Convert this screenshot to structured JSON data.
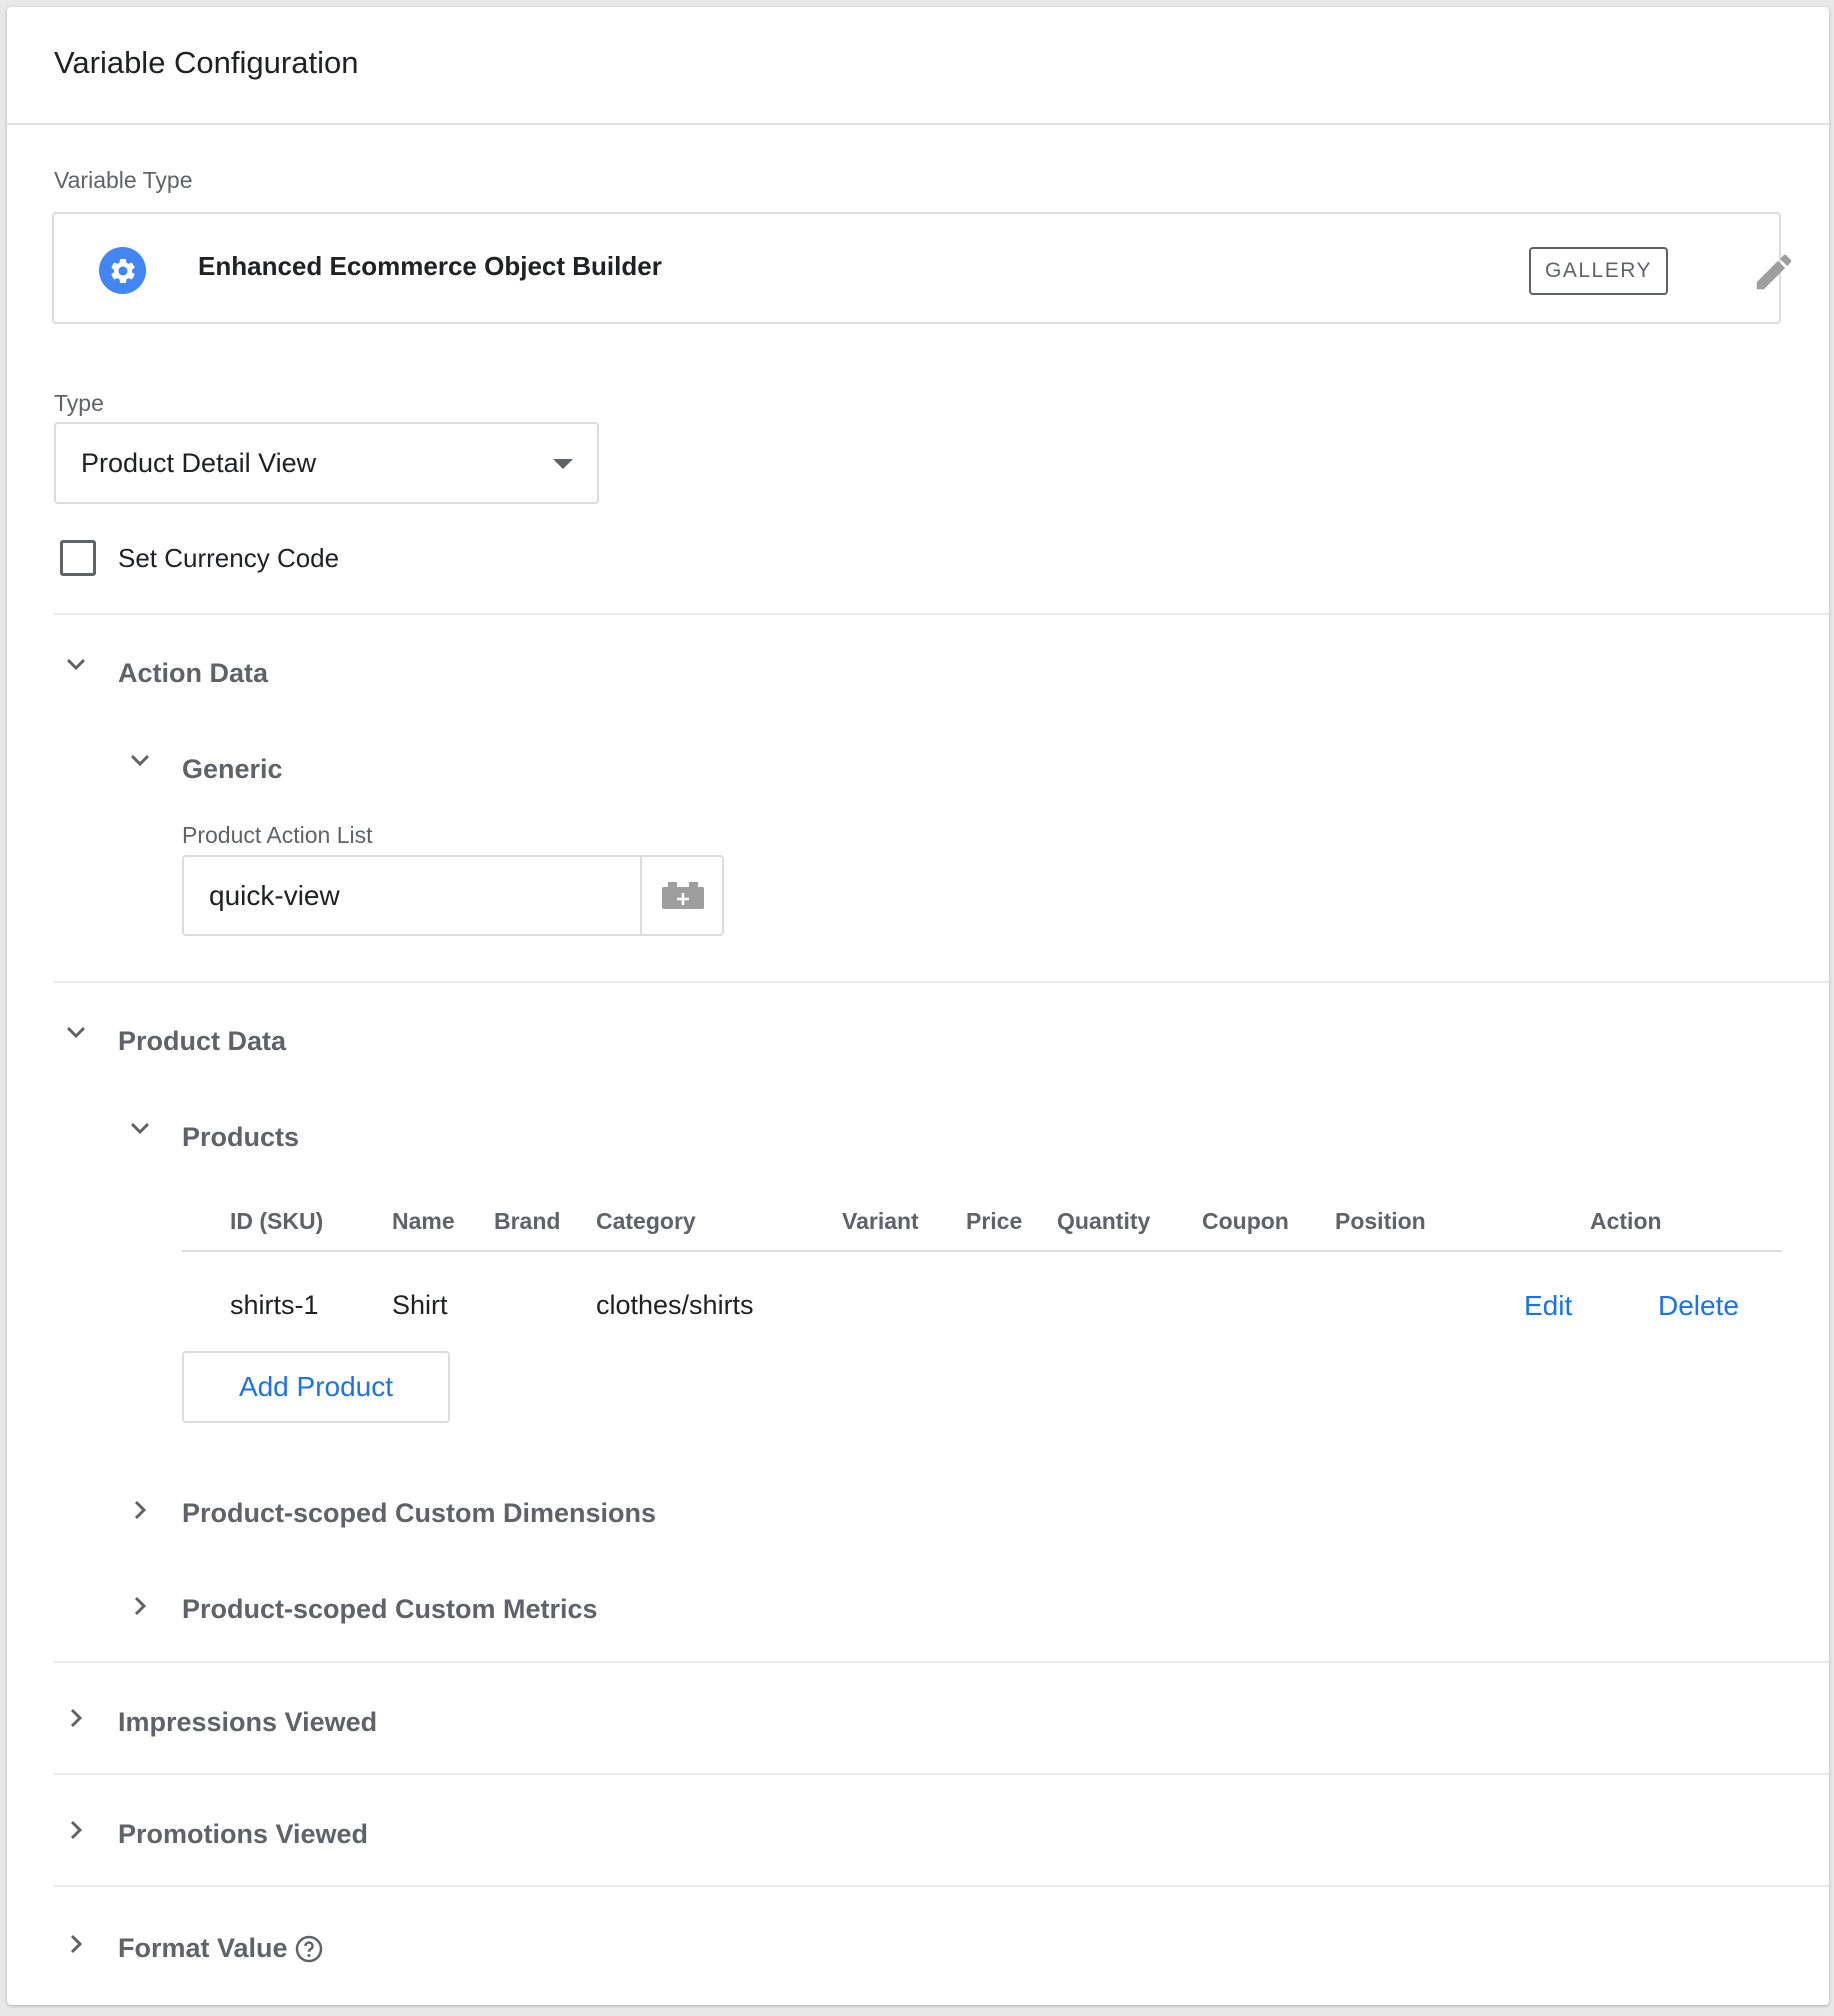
{
  "header": {
    "title": "Variable Configuration"
  },
  "variable_type": {
    "label": "Variable Type",
    "name": "Enhanced Ecommerce Object Builder",
    "gallery_label": "GALLERY",
    "icon": "gear-icon",
    "icon_color": "#4285f4"
  },
  "type_field": {
    "label": "Type",
    "selected": "Product Detail View"
  },
  "currency": {
    "label": "Set Currency Code",
    "checked": false
  },
  "action_data": {
    "title": "Action Data",
    "generic": {
      "title": "Generic",
      "field_label": "Product Action List",
      "field_value": "quick-view"
    }
  },
  "product_data": {
    "title": "Product Data",
    "products": {
      "title": "Products",
      "columns": [
        "ID (SKU)",
        "Name",
        "Brand",
        "Category",
        "Variant",
        "Price",
        "Quantity",
        "Coupon",
        "Position",
        "Action"
      ],
      "rows": [
        {
          "id": "shirts-1",
          "name": "Shirt",
          "brand": "",
          "category": "clothes/shirts",
          "variant": "",
          "price": "",
          "quantity": "",
          "coupon": "",
          "position": ""
        }
      ],
      "edit_label": "Edit",
      "delete_label": "Delete",
      "add_label": "Add Product"
    },
    "custom_dimensions": "Product-scoped Custom Dimensions",
    "custom_metrics": "Product-scoped Custom Metrics"
  },
  "impressions": {
    "title": "Impressions Viewed"
  },
  "promotions": {
    "title": "Promotions Viewed"
  },
  "format_value": {
    "title": "Format Value"
  },
  "colors": {
    "accent": "#1a73e8",
    "brand_icon": "#4285f4",
    "muted_text": "#5f6368"
  }
}
